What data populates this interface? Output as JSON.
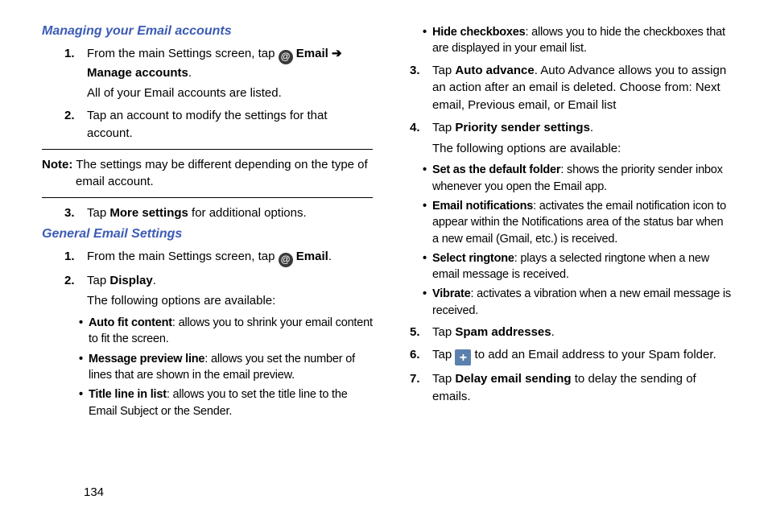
{
  "page_number": "134",
  "left": {
    "h1": "Managing your Email accounts",
    "steps1": [
      {
        "num": "1.",
        "parts": [
          "From the main Settings screen, tap ",
          "@",
          " ",
          "Email",
          " ",
          "➔",
          " ",
          "Manage accounts",
          "."
        ],
        "sub": "All of your Email accounts are listed."
      },
      {
        "num": "2.",
        "parts": [
          "Tap an account to modify the settings for that account."
        ]
      }
    ],
    "note_label": "Note:",
    "note_text": " The settings may be different depending on the type of email account.",
    "steps1b": [
      {
        "num": "3.",
        "parts": [
          "Tap ",
          "More settings",
          " for additional options."
        ]
      }
    ],
    "h2": "General Email Settings",
    "steps2": [
      {
        "num": "1.",
        "parts": [
          "From the main Settings screen, tap ",
          "@",
          " ",
          "Email",
          "."
        ]
      },
      {
        "num": "2.",
        "parts": [
          "Tap ",
          "Display",
          "."
        ],
        "sub": "The following options are available:"
      }
    ],
    "bullets2": [
      {
        "b": "Auto fit content",
        "t": ": allows you to shrink your email content to fit the screen."
      },
      {
        "b": "Message preview line",
        "t": ": allows you set the number of lines that are shown in the email preview."
      },
      {
        "b": "Title line in list",
        "t": ": allows you to set the title line to the Email Subject or the Sender."
      }
    ]
  },
  "right": {
    "bullets_top": [
      {
        "b": "Hide checkboxes",
        "t": ": allows you to hide the checkboxes that are displayed in your email list."
      }
    ],
    "steps": [
      {
        "num": "3.",
        "parts": [
          "Tap ",
          "Auto advance",
          ". Auto Advance allows you to assign an action after an email is deleted. Choose from: Next email, Previous email, or Email list"
        ]
      },
      {
        "num": "4.",
        "parts": [
          "Tap ",
          "Priority sender settings",
          "."
        ],
        "sub": "The following options are available:"
      }
    ],
    "bullets4": [
      {
        "b": "Set as the default folder",
        "t": ": shows the priority sender inbox whenever you open the Email app."
      },
      {
        "b": "Email notifications",
        "t": ": activates the email notification icon to appear within the Notifications area of the status bar when a new email (Gmail, etc.) is received."
      },
      {
        "b": "Select ringtone",
        "t": ": plays a selected ringtone when a new email message is received."
      },
      {
        "b": "Vibrate",
        "t": ": activates a vibration when a new email message is received."
      }
    ],
    "steps_b": [
      {
        "num": "5.",
        "parts": [
          "Tap ",
          "Spam addresses",
          "."
        ]
      },
      {
        "num": "6.",
        "parts": [
          "Tap ",
          "+",
          " to add an Email address to your Spam folder."
        ]
      },
      {
        "num": "7.",
        "parts": [
          "Tap ",
          "Delay email sending",
          " to delay the sending of emails."
        ]
      }
    ]
  }
}
